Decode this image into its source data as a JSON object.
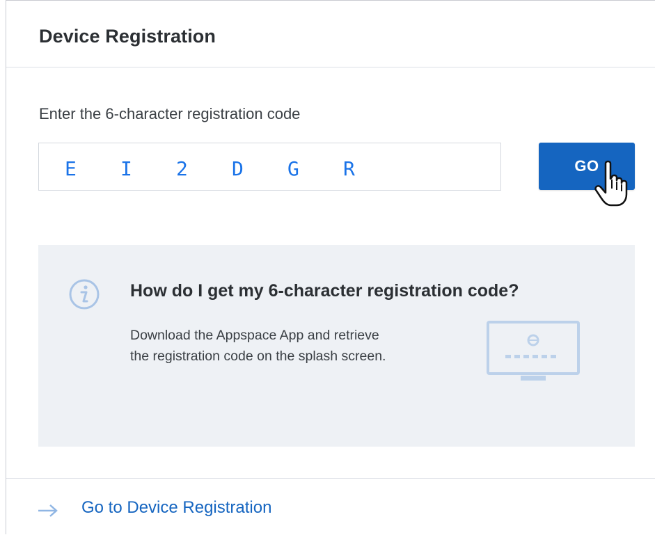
{
  "header": {
    "title": "Device Registration"
  },
  "registration": {
    "instruction": "Enter the 6-character registration code",
    "code_chars": [
      "E",
      "I",
      "2",
      "D",
      "G",
      "R"
    ],
    "go_label": "GO"
  },
  "help": {
    "title": "How do I get my 6-character registration code?",
    "text": "Download the Appspace App and retrieve the registration code on the splash screen."
  },
  "footer": {
    "link_label": "Go to Device Registration"
  },
  "colors": {
    "accent": "#1565c0",
    "code_text": "#1a73e8",
    "help_bg": "#eef1f5",
    "icon_light": "#a9c4e6"
  },
  "icons": {
    "info": "info-icon",
    "monitor": "monitor-icon",
    "arrow": "arrow-right-icon",
    "cursor": "hand-pointer-cursor"
  }
}
